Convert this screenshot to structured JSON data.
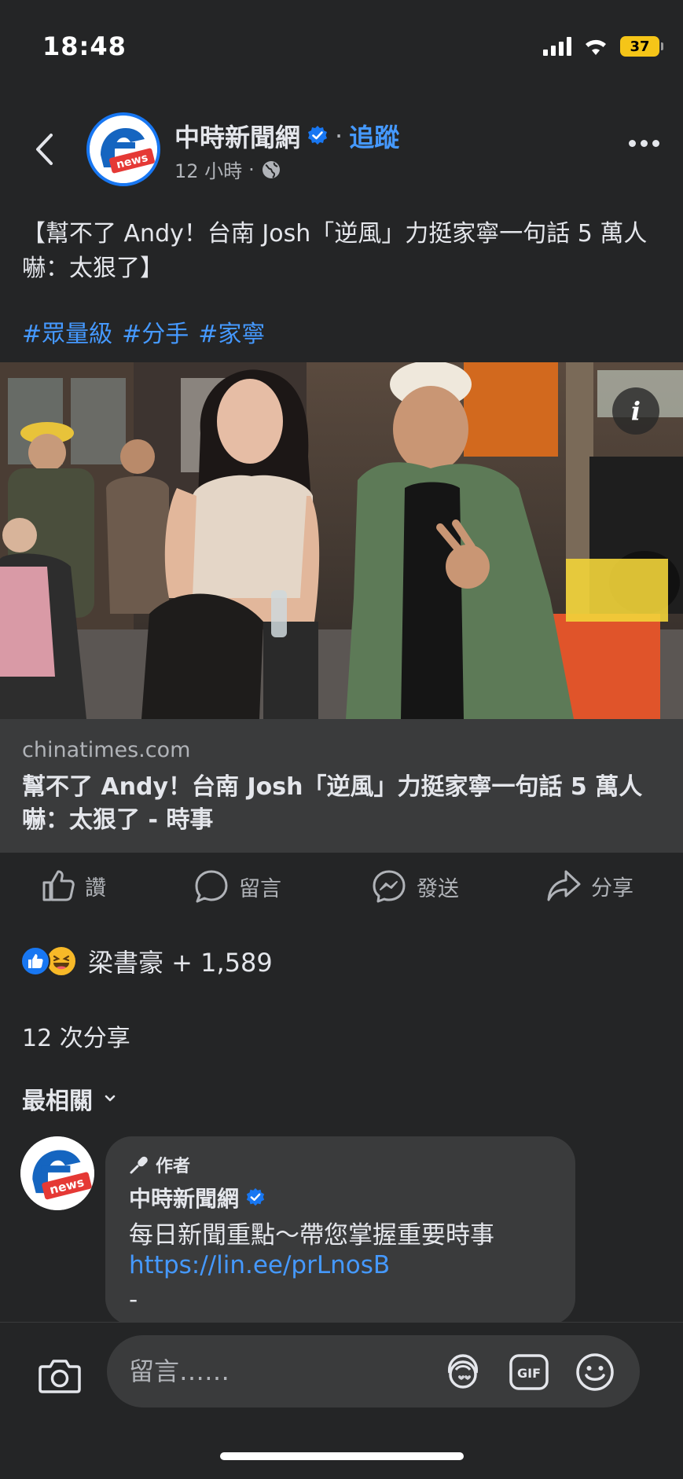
{
  "status": {
    "time": "18:48",
    "battery": "37"
  },
  "page": {
    "name": "中時新聞網",
    "follow": "追蹤",
    "time_ago": "12 小時",
    "avatar_text": "news"
  },
  "post": {
    "text": "【幫不了 Andy！台南 Josh「逆風」力挺家寧一句話 5 萬人嚇：太狠了】",
    "hashtags": [
      "#眾量級",
      "#分手",
      "#家寧"
    ]
  },
  "link": {
    "domain": "chinatimes.com",
    "title": "幫不了 Andy！台南 Josh「逆風」力挺家寧一句話 5 萬人嚇：太狠了 - 時事"
  },
  "actions": {
    "like": "讚",
    "comment": "留言",
    "send": "發送",
    "share": "分享"
  },
  "reactions": {
    "text": "梁書豪 + 1,589"
  },
  "shares": "12 次分享",
  "sort_label": "最相關",
  "comment": {
    "author_badge": "作者",
    "name": "中時新聞網",
    "text": "每日新聞重點～帶您掌握重要時事",
    "link": "https://lin.ee/prLnosB",
    "extra": "-"
  },
  "composer": {
    "placeholder": "留言……"
  },
  "colors": {
    "link_blue": "#4599ff",
    "verified_blue": "#1877f2",
    "background": "#242526",
    "card": "#3a3b3c"
  }
}
